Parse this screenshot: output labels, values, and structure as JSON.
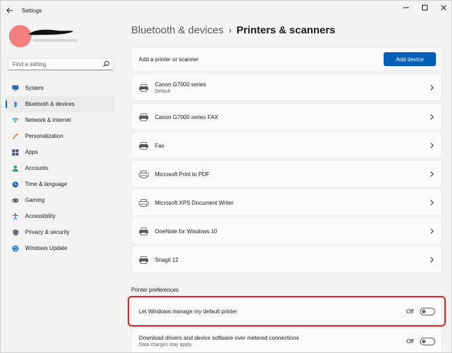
{
  "window": {
    "title": "Settings"
  },
  "search": {
    "placeholder": "Find a setting"
  },
  "sidebar": {
    "items": [
      {
        "label": "System",
        "icon": "system-icon",
        "active": false
      },
      {
        "label": "Bluetooth & devices",
        "icon": "bluetooth-icon",
        "active": true
      },
      {
        "label": "Network & internet",
        "icon": "network-icon",
        "active": false
      },
      {
        "label": "Personalization",
        "icon": "brush-icon",
        "active": false
      },
      {
        "label": "Apps",
        "icon": "apps-icon",
        "active": false
      },
      {
        "label": "Accounts",
        "icon": "accounts-icon",
        "active": false
      },
      {
        "label": "Time & language",
        "icon": "globe-clock-icon",
        "active": false
      },
      {
        "label": "Gaming",
        "icon": "gaming-icon",
        "active": false
      },
      {
        "label": "Accessibility",
        "icon": "accessibility-icon",
        "active": false
      },
      {
        "label": "Privacy & security",
        "icon": "shield-icon",
        "active": false
      },
      {
        "label": "Windows Update",
        "icon": "update-icon",
        "active": false
      }
    ]
  },
  "breadcrumb": {
    "parent": "Bluetooth & devices",
    "separator": "›",
    "current": "Printers & scanners"
  },
  "add_printer": {
    "label": "Add a printer or scanner",
    "button": "Add device"
  },
  "printers": [
    {
      "name": "Canon G7000 series",
      "status": "Default",
      "icon": "printer-icon"
    },
    {
      "name": "Canon G7000 series FAX",
      "status": "",
      "icon": "printer-icon"
    },
    {
      "name": "Fax",
      "status": "",
      "icon": "printer-icon"
    },
    {
      "name": "Microsoft Print to PDF",
      "status": "",
      "icon": "virtual-printer-icon"
    },
    {
      "name": "Microsoft XPS Document Writer",
      "status": "",
      "icon": "virtual-printer-icon"
    },
    {
      "name": "OneNote for Windows 10",
      "status": "",
      "icon": "printer-icon"
    },
    {
      "name": "Snagit 12",
      "status": "",
      "icon": "printer-icon"
    }
  ],
  "preferences": {
    "title": "Printer preferences",
    "items": [
      {
        "label": "Let Windows manage my default printer",
        "sub": "",
        "state": "Off",
        "on": false
      },
      {
        "label": "Download drivers and device software over metered connections",
        "sub": "Data charges may apply",
        "state": "Off",
        "on": false
      }
    ]
  },
  "colors": {
    "accent": "#005fb8",
    "highlight": "#e02020",
    "avatar": "#f07f7f"
  }
}
